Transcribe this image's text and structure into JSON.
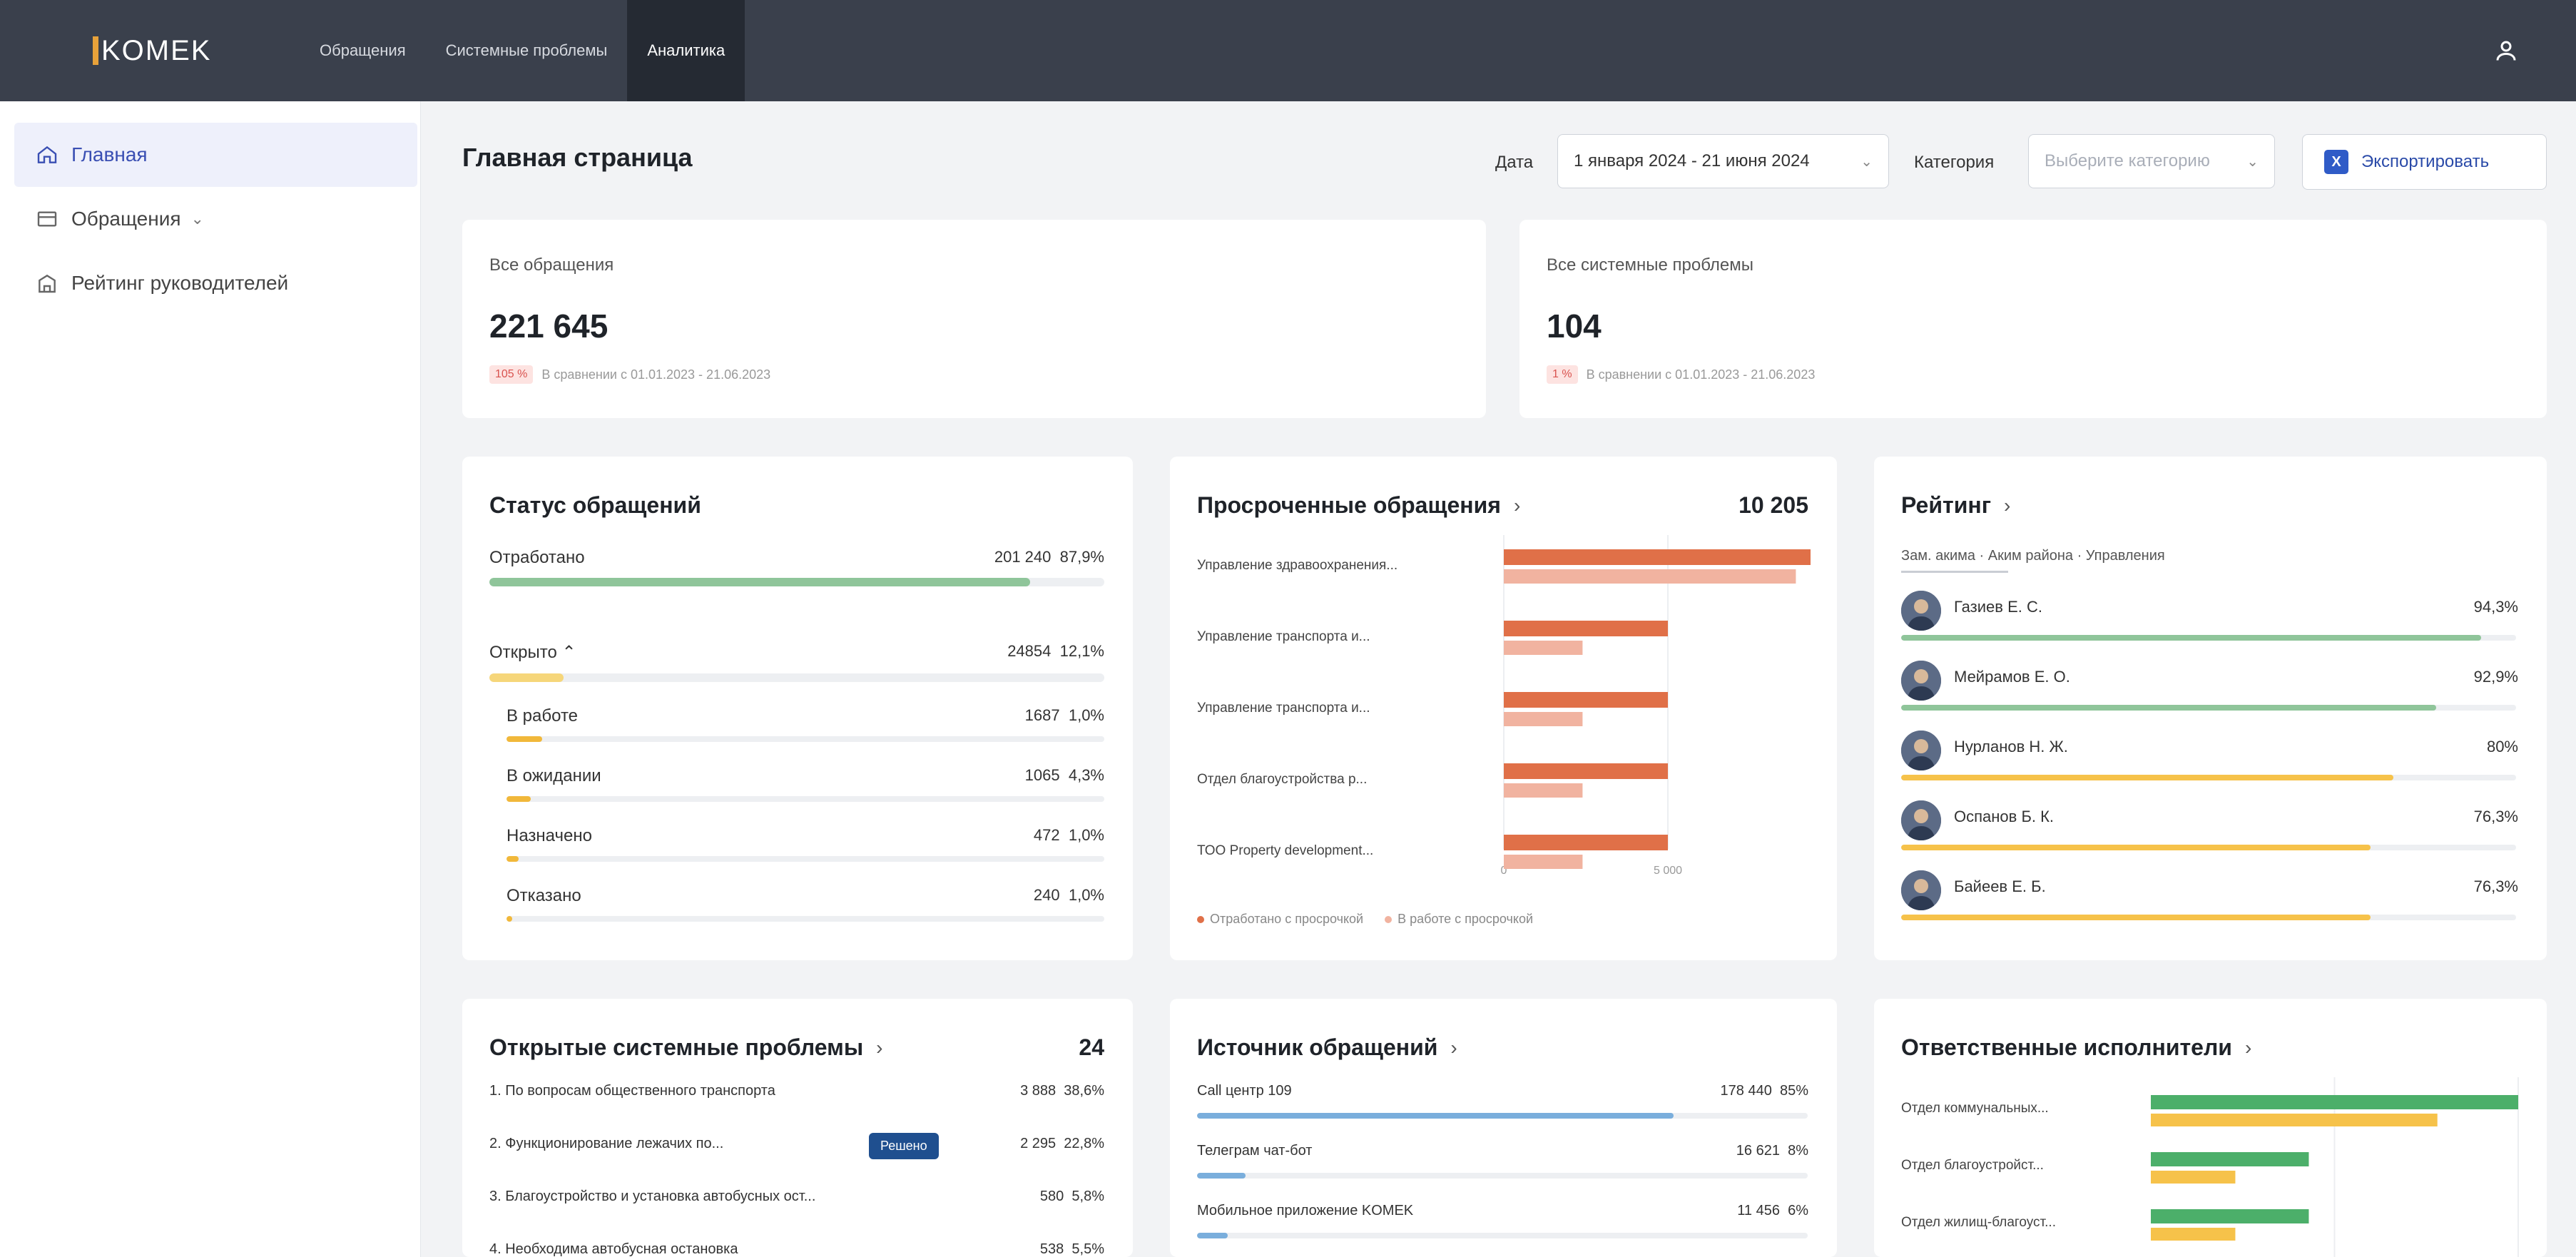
{
  "app": {
    "logo": "KOMEK"
  },
  "nav": [
    {
      "label": "Обращения"
    },
    {
      "label": "Системные проблемы"
    },
    {
      "label": "Аналитика"
    }
  ],
  "sidebar": [
    {
      "label": "Главная"
    },
    {
      "label": "Обращения"
    },
    {
      "label": "Рейтинг руководителей"
    }
  ],
  "header": {
    "title": "Главная страница",
    "date_label": "Дата",
    "date_value": "1 января 2024 - 21 июня 2024",
    "category_label": "Категория",
    "category_placeholder": "Выберите категорию",
    "export_label": "Экспортировать",
    "export_icon_letter": "X"
  },
  "kpi": [
    {
      "label": "Все обращения",
      "value": "221 645",
      "badge": "105 %",
      "note": "В сравнении с 01.01.2023 - 21.06.2023"
    },
    {
      "label": "Все системные проблемы",
      "value": "104",
      "badge": "1 %",
      "note": "В сравнении с 01.01.2023 - 21.06.2023"
    }
  ],
  "status": {
    "title": "Статус обращений",
    "rows": [
      {
        "label": "Отработано",
        "value": "201 240",
        "pct": "87,9%",
        "fill": 0.879,
        "color": "#8fc59a",
        "caret": ""
      },
      {
        "label": "Открыто",
        "value": "24854",
        "pct": "12,1%",
        "fill": 0.121,
        "color": "#f6d67a",
        "caret": "⌃"
      }
    ],
    "subrows": [
      {
        "label": "В работе",
        "value": "1687",
        "pct": "1,0%",
        "fill": 0.06,
        "color": "#f1b83a"
      },
      {
        "label": "В ожидании",
        "value": "1065",
        "pct": "4,3%",
        "fill": 0.04,
        "color": "#f1b83a"
      },
      {
        "label": "Назначено",
        "value": "472",
        "pct": "1,0%",
        "fill": 0.02,
        "color": "#f1b83a"
      },
      {
        "label": "Отказано",
        "value": "240",
        "pct": "1,0%",
        "fill": 0.01,
        "color": "#f1b83a"
      }
    ]
  },
  "overdue": {
    "title": "Просроченные обращения",
    "arrow": "›",
    "total": "10 205",
    "legend": [
      "Отработано с просрочкой",
      "В работе с просрочкой"
    ],
    "ticks": [
      "0",
      "5 000",
      "10 000"
    ],
    "colors": {
      "primary": "#e07048",
      "secondary": "#f1b3a0"
    }
  },
  "rating": {
    "title": "Рейтинг",
    "arrow": "›",
    "tabs": "Зам. акима · Аким района · Управления",
    "people": [
      {
        "name": "Газиев Е. С.",
        "pct": "94,3%",
        "fill": 0.943,
        "color": "#8fc59a"
      },
      {
        "name": "Мейрамов Е. О.",
        "pct": "92,9%",
        "fill": 0.87,
        "color": "#8fc59a"
      },
      {
        "name": "Нурланов Н. Ж.",
        "pct": "80%",
        "fill": 0.8,
        "color": "#f6c24a"
      },
      {
        "name": "Оспанов Б. К.",
        "pct": "76,3%",
        "fill": 0.763,
        "color": "#f6c24a"
      },
      {
        "name": "Байеев Е. Б.",
        "pct": "76,3%",
        "fill": 0.763,
        "color": "#f6c24a"
      }
    ]
  },
  "problems": {
    "title": "Открытые системные проблемы",
    "arrow": "›",
    "total": "24",
    "rows": [
      {
        "label": "1. По вопросам общественного транспорта",
        "value": "3 888",
        "pct": "38,6%"
      },
      {
        "label": "2. Функционирование лежачих по...",
        "value": "2 295",
        "pct": "22,8%"
      },
      {
        "label": "3. Благоустройство и установка автобусных ост...",
        "value": "580",
        "pct": "5,8%"
      },
      {
        "label": "4. Необходима автобусная остановка",
        "value": "538",
        "pct": "5,5%"
      }
    ],
    "resolve_label": "Решено"
  },
  "sources": {
    "title": "Источник обращений",
    "arrow": "›",
    "rows": [
      {
        "label": "Call центр 109",
        "value": "178 440",
        "pct": "85%",
        "fill": 0.78
      },
      {
        "label": "Телеграм чат-бот",
        "value": "16 621",
        "pct": "8%",
        "fill": 0.08
      },
      {
        "label": "Мобильное приложение KOMEK",
        "value": "11 456",
        "pct": "6%",
        "fill": 0.05
      }
    ],
    "color": "#7aaedc"
  },
  "executors": {
    "title": "Ответственные исполнители",
    "arrow": "›",
    "rows": [
      {
        "label": "Отдел коммунальных...",
        "done": 1.0,
        "open": 0.78
      },
      {
        "label": "Отдел благоустройст...",
        "done": 0.43,
        "open": 0.23
      },
      {
        "label": "Отдел жилищ-благоуст...",
        "done": 0.43,
        "open": 0.23
      }
    ],
    "colors": {
      "done": "#4caf6a",
      "open": "#f6c24a"
    }
  }
}
